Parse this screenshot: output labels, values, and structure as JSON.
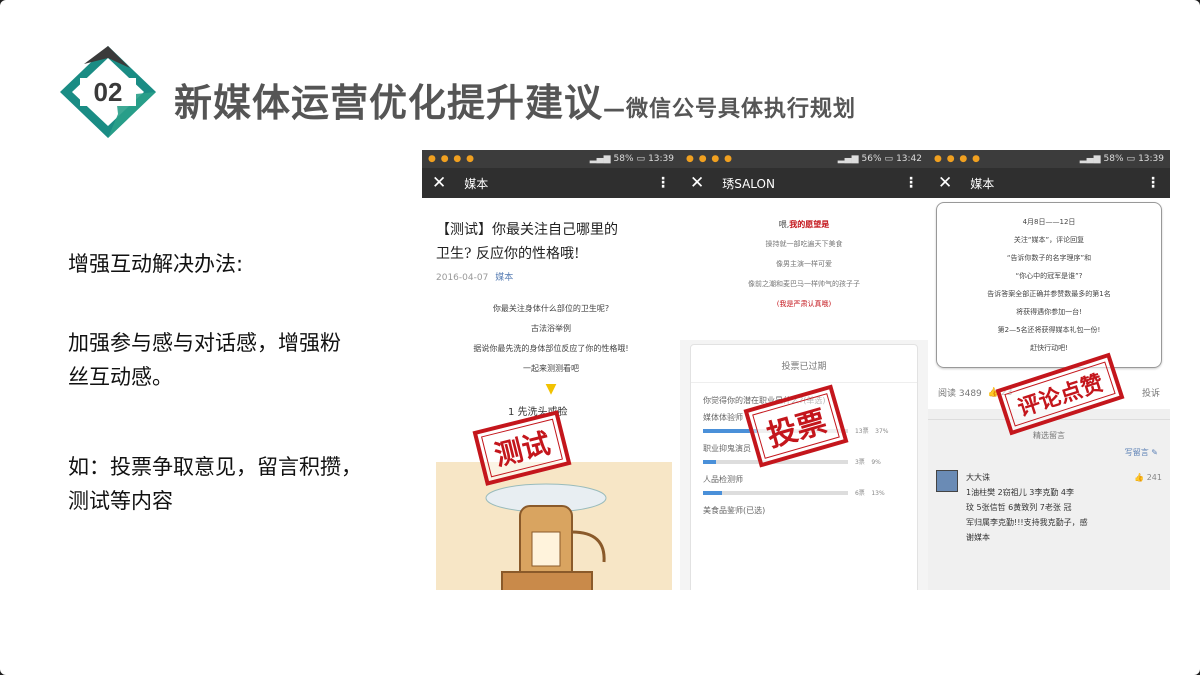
{
  "header": {
    "badge_number": "02",
    "title": "新媒体运营优化提升建议",
    "subtitle": "—微信公号具体执行规划",
    "colors": {
      "teal": "#1a8c84",
      "dark": "#3a3a3a",
      "green": "#1f8f6f"
    }
  },
  "left": {
    "heading": "增强互动解决办法:",
    "point1_line1": "加强参与感与对话感，增强粉",
    "point1_line2": "丝互动感。",
    "point2_line1": "如：投票争取意见，留言积攒，",
    "point2_line2": "测试等内容"
  },
  "phone1": {
    "status_time": "13:39",
    "status_battery": "58%",
    "nav_title": "媒本",
    "article_title_line1": "【测试】你最关注自己哪里的",
    "article_title_line2": "卫生? 反应你的性格哦!",
    "date": "2016-04-07",
    "author": "媒本",
    "body": [
      "你最关注身体什么部位的卫生呢?",
      "古法浴举例",
      "据说你最先洗的身体部位反应了你的性格哦!",
      "一起来测测看吧"
    ],
    "option": "1  先洗头或脸",
    "stamp": "测试"
  },
  "phone2": {
    "status_time": "13:42",
    "status_battery": "56%",
    "nav_title": "琇SALON",
    "wish_prefix": "喂,",
    "wish_title": "我的愿望是",
    "lines": [
      "操持就一部吃遍天下美食",
      "像男主演一样可爱",
      "像前之潮和麦巴马一样帅气的孩子子"
    ],
    "footnote": "(我是严肃认真哦)",
    "poll_closed": "投票已过期",
    "poll_question": "你觉得你的潜在职业是什么?(单选)",
    "options": [
      {
        "label": "媒体体验师",
        "votes": "13票",
        "pct": "37%",
        "fill": 37
      },
      {
        "label": "职业抑鬼演员",
        "votes": "3票",
        "pct": "9%",
        "fill": 9
      },
      {
        "label": "人品检测师",
        "votes": "6票",
        "pct": "13%",
        "fill": 13
      },
      {
        "label": "美食品鉴师(已选)",
        "votes": "",
        "pct": "",
        "fill": 0
      }
    ],
    "stamp": "投票"
  },
  "phone3": {
    "status_time": "13:39",
    "status_battery": "58%",
    "nav_title": "媒本",
    "box_lines": [
      "4月8日——12日",
      "关注“媒本”，评论回复",
      "“告诉你数子的名字理序”和",
      "“你心中的冠军是谁”?",
      "告诉答案全部正确并参赞数最多的第1名",
      "将获得遇你参加一台!",
      "第2—5名还将获得媒本礼包一份!",
      "赶快行动吧!"
    ],
    "reads": "阅读 3489",
    "likes": "23",
    "report": "投诉",
    "featured": "精选留言",
    "write": "写留言",
    "commenter": "大大诛",
    "comment_likes": "241",
    "comment_line1": "1油柱樊     2窃祖儿      3李克勤     4李",
    "comment_line2": "玟  5张信哲   6黄致列   7老张  冠",
    "comment_line3": "军归属李克勤!!!支持我克勤子，感",
    "comment_line4": "谢媒本",
    "stamp": "评论点赞"
  }
}
